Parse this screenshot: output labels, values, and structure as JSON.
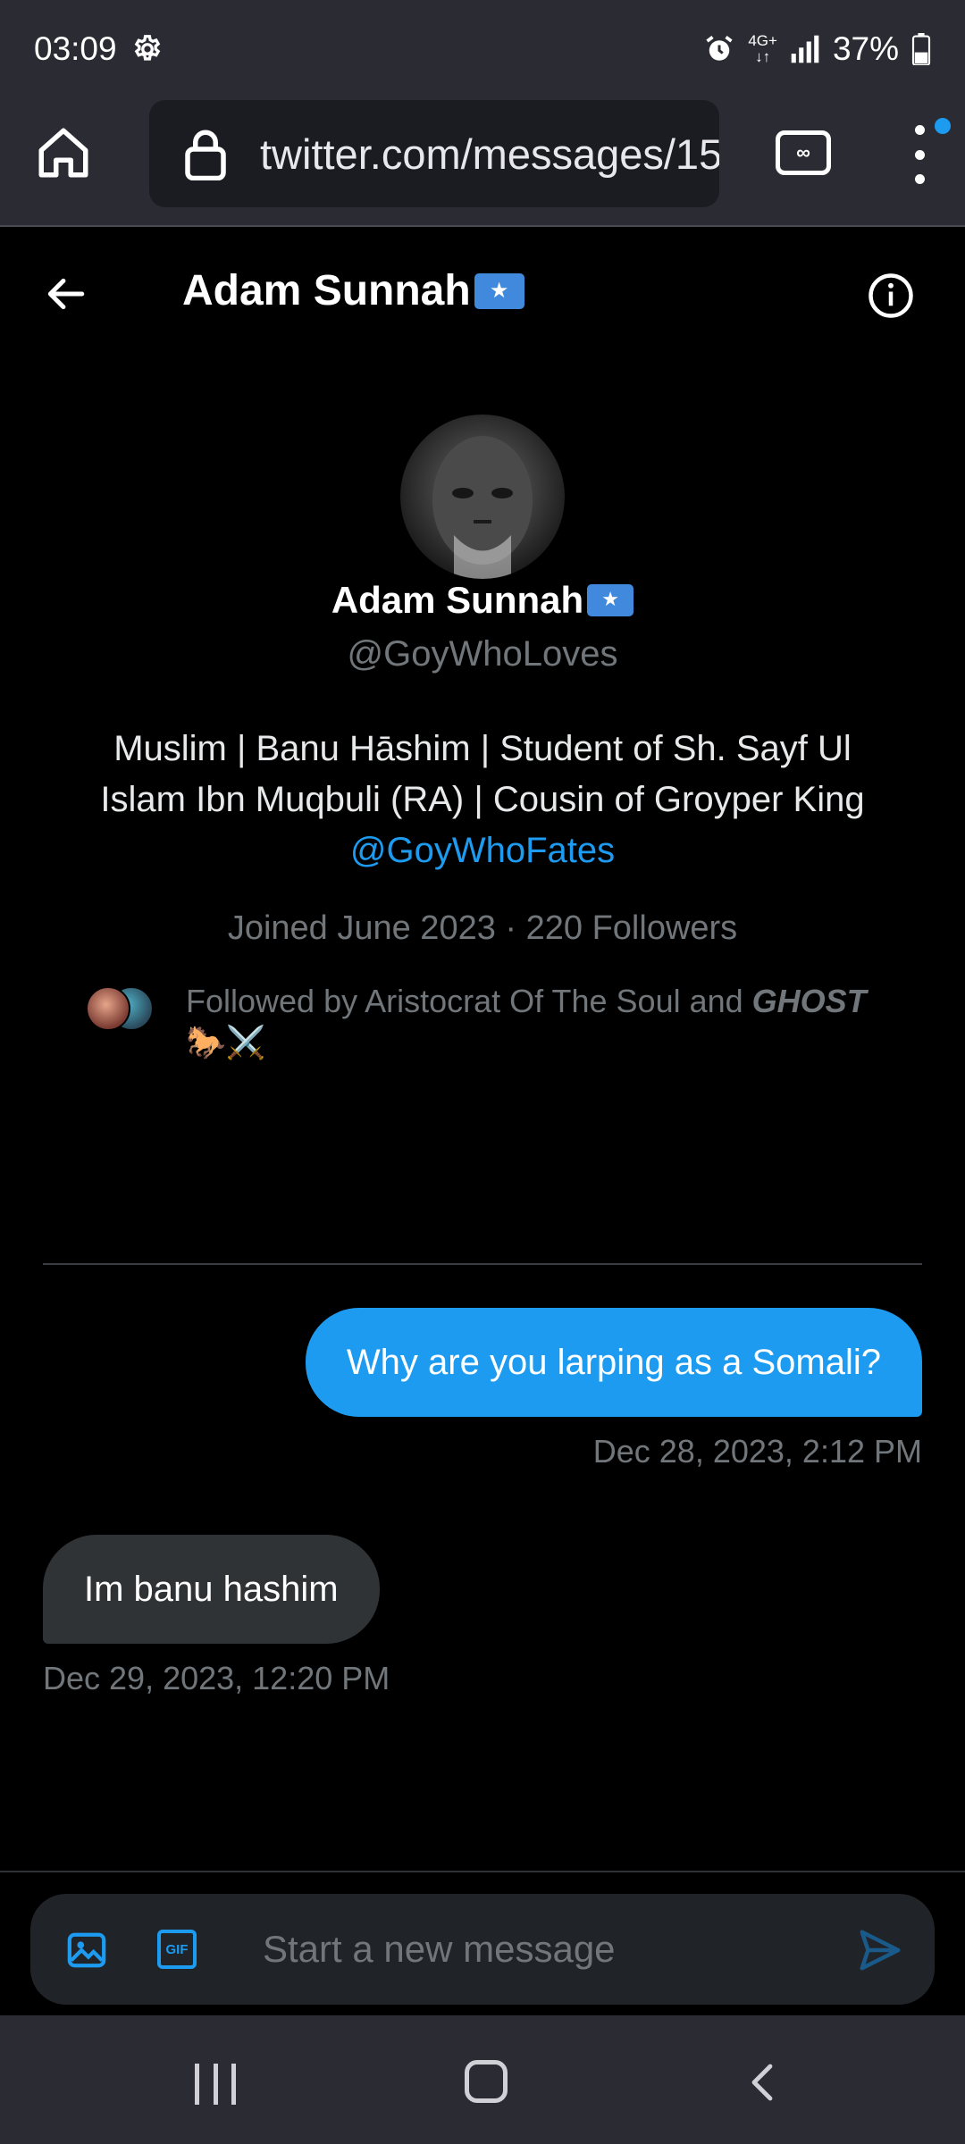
{
  "status_bar": {
    "time": "03:09",
    "network": "4G+",
    "battery": "37%",
    "icons": [
      "settings-gear-icon",
      "alarm-icon",
      "network-4g-icon",
      "signal-icon",
      "battery-icon"
    ]
  },
  "browser": {
    "url": "twitter.com/messages/15",
    "tabs_count": "∞",
    "icons": [
      "home-icon",
      "lock-icon",
      "tabs-icon",
      "more-vert-icon"
    ]
  },
  "conversation": {
    "title": "Adam Sunnah"
  },
  "profile": {
    "name": "Adam Sunnah",
    "handle": "@GoyWhoLoves",
    "bio_text": "Muslim | Banu Hāshim | Student of Sh. Sayf Ul Islam Ibn Muqbuli (RA) | Cousin of Groyper King ",
    "bio_mention": "@GoyWhoFates",
    "joined": "Joined June 2023",
    "separator": "·",
    "followers": "220 Followers",
    "followed_by_prefix": "Followed by Aristocrat Of The Soul and ",
    "followed_by_bold": "GHOST",
    "followed_by_emoji": "🐎⚔️"
  },
  "messages": [
    {
      "direction": "outgoing",
      "text": "Why are you larping as a Somali?",
      "time": "Dec 28, 2023, 2:12 PM"
    },
    {
      "direction": "incoming",
      "text": "Im banu hashim",
      "time": "Dec 29, 2023, 12:20 PM"
    }
  ],
  "composer": {
    "placeholder": "Start a new message",
    "gif_label": "GIF"
  },
  "colors": {
    "accent": "#1d9bf0",
    "background": "#000000",
    "incoming_bubble": "#2f3336",
    "muted_text": "#71767b",
    "system_bar": "#2b2b33"
  }
}
